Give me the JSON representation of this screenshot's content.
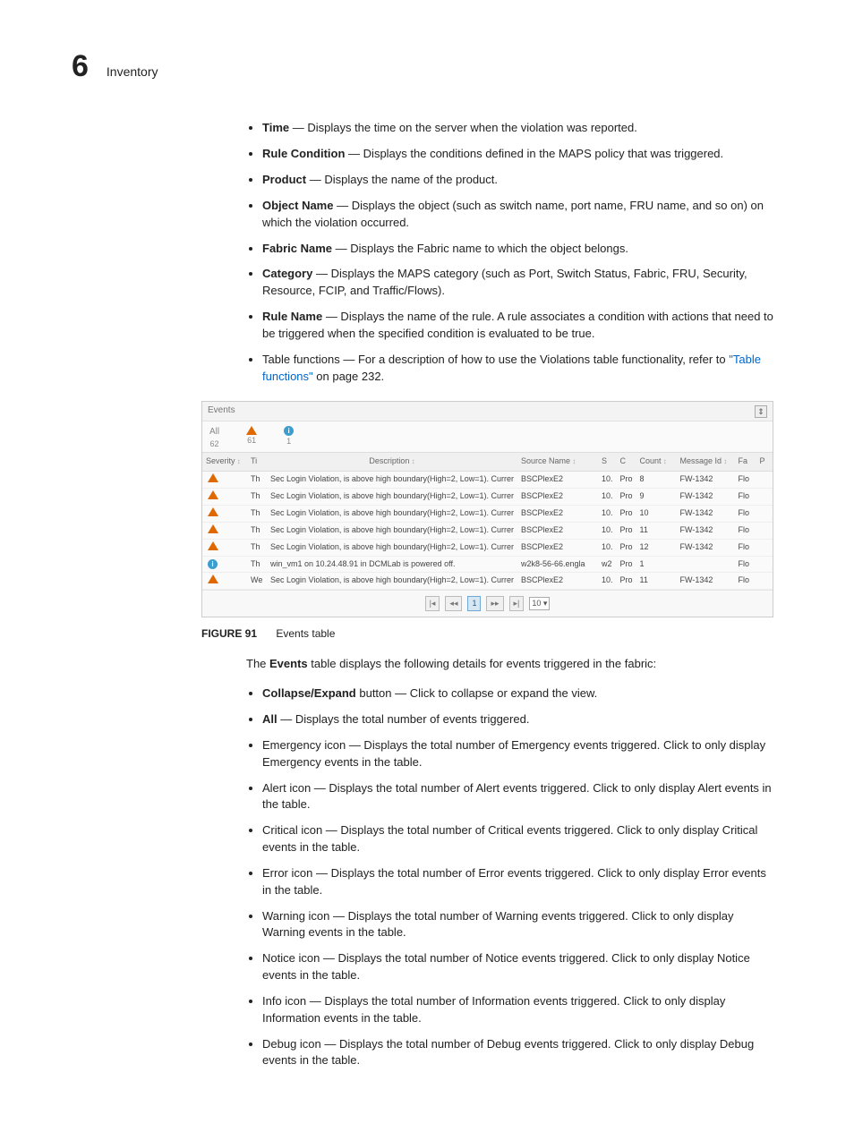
{
  "header": {
    "chapter_number": "6",
    "chapter_title": "Inventory"
  },
  "violations_fields": [
    {
      "term": "Time",
      "desc": " — Displays the time on the server when the violation was reported."
    },
    {
      "term": "Rule Condition",
      "desc": " — Displays the conditions defined in the MAPS policy that was triggered."
    },
    {
      "term": "Product",
      "desc": " — Displays the name of the product."
    },
    {
      "term": "Object Name",
      "desc": " — Displays the object (such as switch name, port name, FRU name, and so on) on which the violation occurred."
    },
    {
      "term": "Fabric Name",
      "desc": " — Displays the Fabric name to which the object belongs."
    },
    {
      "term": "Category",
      "desc": " — Displays the MAPS category (such as Port, Switch Status, Fabric, FRU, Security, Resource, FCIP, and Traffic/Flows)."
    },
    {
      "term": "Rule Name",
      "desc": " — Displays the name of the rule. A rule associates a condition with actions that need to be triggered when the specified condition is evaluated to be true."
    }
  ],
  "table_functions_prefix": "Table functions — For a description of how to use the Violations table functionality, refer to ",
  "table_functions_link": "\"Table functions\"",
  "table_functions_suffix": " on page 232.",
  "events_panel": {
    "title": "Events",
    "filters": {
      "all_label": "All",
      "all_count": "62",
      "warn_count": "61",
      "info_count": "1"
    },
    "headers": {
      "severity": "Severity",
      "ti": "Ti",
      "description": "Description",
      "source_name": "Source Name",
      "s": "S",
      "c": "C",
      "count": "Count",
      "message_id": "Message Id",
      "fa": "Fa",
      "p": "P"
    },
    "rows": [
      {
        "icon": "warn",
        "ti": "Th",
        "desc": "Sec Login Violation, is above high boundary(High=2, Low=1). Currer",
        "src": "BSCPlexE2",
        "s": "10.",
        "c": "Pro",
        "count": "8",
        "msg": "FW-1342",
        "fa": "Flo"
      },
      {
        "icon": "warn",
        "ti": "Th",
        "desc": "Sec Login Violation, is above high boundary(High=2, Low=1). Currer",
        "src": "BSCPlexE2",
        "s": "10.",
        "c": "Pro",
        "count": "9",
        "msg": "FW-1342",
        "fa": "Flo"
      },
      {
        "icon": "warn",
        "ti": "Th",
        "desc": "Sec Login Violation, is above high boundary(High=2, Low=1). Currer",
        "src": "BSCPlexE2",
        "s": "10.",
        "c": "Pro",
        "count": "10",
        "msg": "FW-1342",
        "fa": "Flo"
      },
      {
        "icon": "warn",
        "ti": "Th",
        "desc": "Sec Login Violation, is above high boundary(High=2, Low=1). Currer",
        "src": "BSCPlexE2",
        "s": "10.",
        "c": "Pro",
        "count": "11",
        "msg": "FW-1342",
        "fa": "Flo"
      },
      {
        "icon": "warn",
        "ti": "Th",
        "desc": "Sec Login Violation, is above high boundary(High=2, Low=1). Currer",
        "src": "BSCPlexE2",
        "s": "10.",
        "c": "Pro",
        "count": "12",
        "msg": "FW-1342",
        "fa": "Flo"
      },
      {
        "icon": "info",
        "ti": "Th",
        "desc": "win_vm1 on 10.24.48.91 in DCMLab is powered off.",
        "src": "w2k8-56-66.engla",
        "s": "w2",
        "c": "Pro",
        "count": "1",
        "msg": "",
        "fa": "Flo"
      },
      {
        "icon": "warn",
        "ti": "We",
        "desc": "Sec Login Violation, is above high boundary(High=2, Low=1). Currer",
        "src": "BSCPlexE2",
        "s": "10.",
        "c": "Pro",
        "count": "11",
        "msg": "FW-1342",
        "fa": "Flo"
      }
    ],
    "pagination": {
      "first": "|◂",
      "prev": "◂◂",
      "page": "1",
      "next": "▸▸",
      "last": "▸|",
      "page_size": "10"
    }
  },
  "figure": {
    "number": "FIGURE 91",
    "caption": "Events table"
  },
  "events_intro_prefix": "The ",
  "events_intro_bold": "Events",
  "events_intro_suffix": " table displays the following details for events triggered in the fabric:",
  "events_fields": [
    {
      "term": "Collapse/Expand",
      "desc": " button — Click to collapse or expand the view."
    },
    {
      "term": "All",
      "desc": " — Displays the total number of events triggered."
    },
    {
      "term": "",
      "desc": "Emergency icon — Displays the total number of Emergency events triggered. Click to only display Emergency events in the table."
    },
    {
      "term": "",
      "desc": "Alert icon — Displays the total number of Alert events triggered. Click to only display Alert events in the table."
    },
    {
      "term": "",
      "desc": "Critical icon — Displays the total number of Critical events triggered. Click to only display Critical events in the table."
    },
    {
      "term": "",
      "desc": "Error icon — Displays the total number of Error events triggered. Click to only display Error events in the table."
    },
    {
      "term": "",
      "desc": "Warning icon — Displays the total number of Warning events triggered. Click to only display Warning events in the table."
    },
    {
      "term": "",
      "desc": "Notice icon — Displays the total number of Notice events triggered. Click to only display Notice events in the table."
    },
    {
      "term": "",
      "desc": "Info icon — Displays the total number of Information events triggered. Click to only display Information events in the table."
    },
    {
      "term": "",
      "desc": "Debug icon — Displays the total number of Debug events triggered. Click to only display Debug events in the table."
    }
  ]
}
